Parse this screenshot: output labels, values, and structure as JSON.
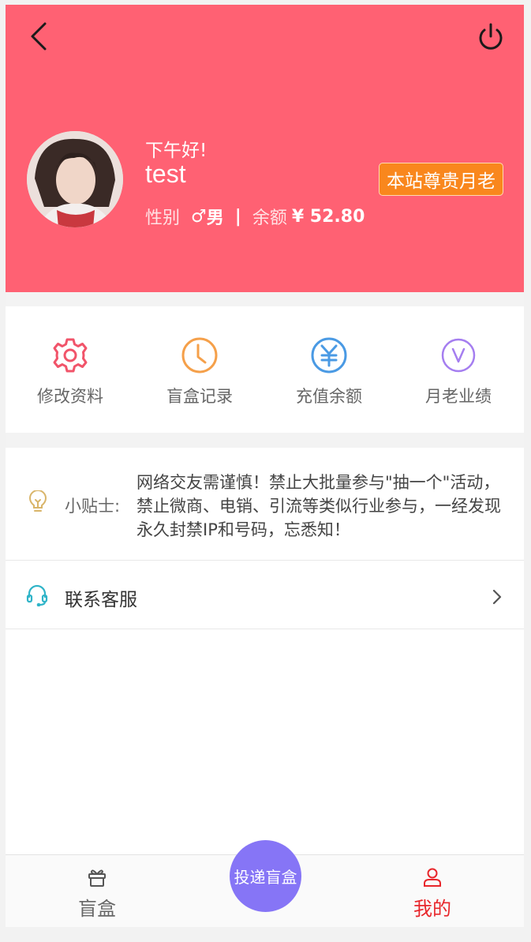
{
  "header": {
    "greeting": "下午好!",
    "username": "test",
    "gender_label": "性别",
    "gender_symbol": "♂",
    "gender_value": "男",
    "separator": "|",
    "balance_label": "余额",
    "balance_value": "¥ 52.80",
    "badge": "本站尊贵月老",
    "accent_color": "#ff6173",
    "badge_color": "#f9871d"
  },
  "menu": {
    "items": [
      {
        "label": "修改资料",
        "icon": "gear-icon",
        "color": "#f1546a"
      },
      {
        "label": "盲盒记录",
        "icon": "clock-icon",
        "color": "#f5a04a"
      },
      {
        "label": "充值余额",
        "icon": "yen-icon",
        "color": "#4a9ae4"
      },
      {
        "label": "月老业绩",
        "icon": "v-circle-icon",
        "color": "#a57ef0"
      }
    ]
  },
  "tip": {
    "label": "小贴士:",
    "text": "网络交友需谨慎！禁止大批量参与\"抽一个\"活动，禁止微商、电销、引流等类似行业参与，一经发现永久封禁IP和号码，忘悉知！",
    "icon": "lightbulb-icon"
  },
  "service": {
    "label": "联系客服",
    "icon": "headset-icon"
  },
  "tabbar": {
    "items": [
      {
        "label": "盲盒",
        "icon": "gift-box-icon",
        "color": "#666666"
      },
      {
        "label": "我的",
        "icon": "user-icon",
        "color": "#e8262b"
      }
    ],
    "fab_label": "投递盲盒",
    "fab_color": "#8675f6"
  }
}
